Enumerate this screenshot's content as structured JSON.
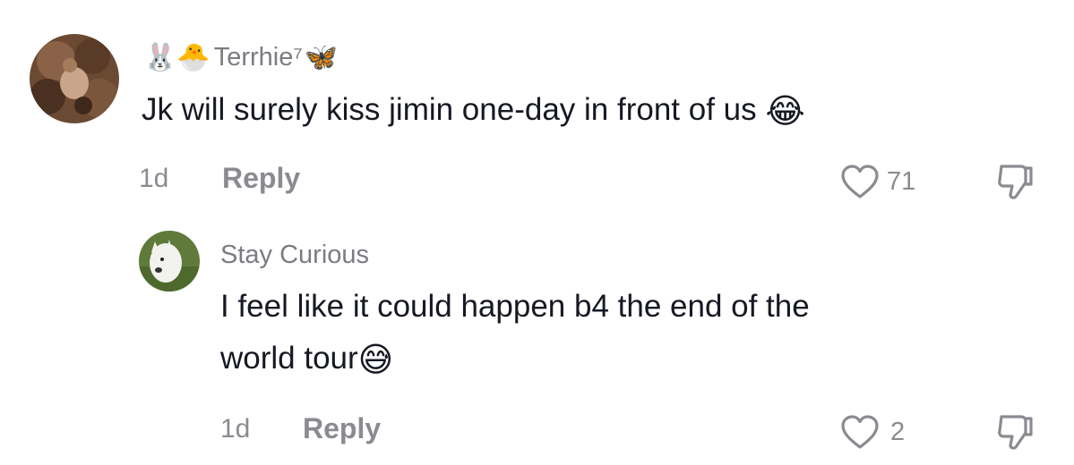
{
  "comments": [
    {
      "username_emoji_prefix": "🐰🐣",
      "username": "Terrhie⁷",
      "username_emoji_suffix": "🦋",
      "text": "Jk will surely kiss jimin one-day in front of us",
      "text_emoji": "😂",
      "time": "1d",
      "reply_label": "Reply",
      "likes": "71"
    },
    {
      "username": "Stay Curious",
      "text_line1": "I feel like it could happen b4 the end of the",
      "text_line2": "world tour",
      "text_emoji": "😅",
      "time": "1d",
      "reply_label": "Reply",
      "likes": "2"
    }
  ],
  "icons": {
    "like": "heart-outline-icon",
    "dislike": "thumbs-down-outline-icon"
  }
}
